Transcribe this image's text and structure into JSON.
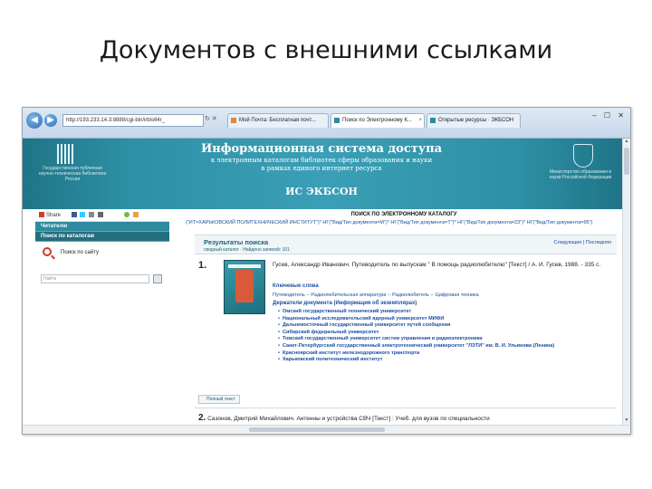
{
  "slide": {
    "title": "Документов с внешними ссылками"
  },
  "browser": {
    "address": "http://193.233.14.3:8888/cgi-bin/irbis64r_",
    "tabs": [
      {
        "label": "Мой Почта: Бесплатная почт..."
      },
      {
        "label": "Поиск по Электронному К..."
      },
      {
        "label": "Открытые ресурсы · ЭКБСОН"
      }
    ]
  },
  "banner": {
    "title": "Информационная система доступа",
    "subtitle_line1": "к электронным каталогам библиотек сферы образования и науки",
    "subtitle_line2": "в рамках единого интернет ресурса",
    "name": "ИС ЭКБСОН",
    "left_org": "Государственная публичная научно-техническая библиотека России",
    "right_org": "Министерство образования и науки Российской Федерации"
  },
  "sidebar": {
    "share_label": "Share",
    "nav": [
      {
        "label": "Читателю"
      },
      {
        "label": "Поиск по каталогам"
      }
    ],
    "site_search_label": "Поиск по сайту",
    "search_placeholder": "Найти"
  },
  "content": {
    "heading": "ПОИСК ПО ЭЛЕКТРОННОМУ КАТАЛОГУ",
    "query": "(\"ИТ=ХАРЬКОВСКИЙ ПОЛИТЕХНИЧЕСКИЙ ИНСТИТУТ\")* НГ(\"Вид/Тип документа=М\")* НГ(\"Вид/Тип документа=Т\")* НГ(\"Вид/Тип документа=23\")* НГ(\"Вид/Тип документа=95\")",
    "results_title": "Результаты поиска",
    "results_sub": "сводный каталог · Найдено записей: 101",
    "results_links": "Следующие | Последняя",
    "record1": {
      "number": "1.",
      "citation": "Гусев, Александр Иванович. Путеводитель по выпускам \" В помощь радиолюбителю\" [Текст] / А. И. Гусев, 1988. - 335 с.",
      "keywords_label": "Ключевые слова",
      "rubrics": "Путеводитель -- Радиолюбительская аппаратура -- Радиолюбитель -- Цифровая техника",
      "holders_label": "Держатели документа (Информация об экземплярах)",
      "holders": [
        "Омский государственный технический университет",
        "Национальный исследовательский ядерный университет МИФИ",
        "Дальневосточный государственный университет путей сообщения",
        "Сибирский федеральный университет",
        "Томский государственный университет систем управления и радиоэлектроники",
        "Санкт-Петербургский государственный электротехнический университет \"ЛЭТИ\" им. В. И. Ульянова (Ленина)",
        "Красноярский институт железнодорожного транспорта",
        "Харьковский политехнический институт"
      ],
      "fulltext_label": "Полный текст"
    },
    "record2": {
      "number": "2.",
      "citation": "Сазонов, Дмитрий Михайлович. Антенны и устройства СВЧ [Текст] : Учеб. для вузов по специальности"
    }
  }
}
